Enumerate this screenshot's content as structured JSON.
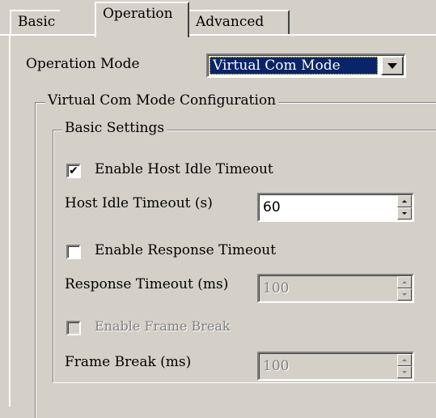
{
  "tabs": [
    {
      "label": "Basic"
    },
    {
      "label": "Operation"
    },
    {
      "label": "Advanced"
    }
  ],
  "operation_mode": {
    "label": "Operation Mode",
    "selected": "Virtual Com Mode"
  },
  "virtual_com_group": {
    "title": "Virtual Com Mode Configuration"
  },
  "basic_settings": {
    "title": "Basic Settings",
    "enable_host_idle_timeout": {
      "label": "Enable Host Idle Timeout",
      "checked": true,
      "mark": "✔"
    },
    "host_idle_timeout": {
      "label": "Host Idle Timeout (s)",
      "value": "60"
    },
    "enable_response_timeout": {
      "label": "Enable Response Timeout",
      "checked": false
    },
    "response_timeout": {
      "label": "Response Timeout (ms)",
      "value": "100"
    },
    "enable_frame_break": {
      "label": "Enable Frame Break",
      "checked": false
    },
    "frame_break": {
      "label": "Frame Break (ms)",
      "value": "100"
    }
  },
  "colors": {
    "face": "#d4d0c8",
    "selection": "#0a246a",
    "disabled_text": "#808080"
  }
}
